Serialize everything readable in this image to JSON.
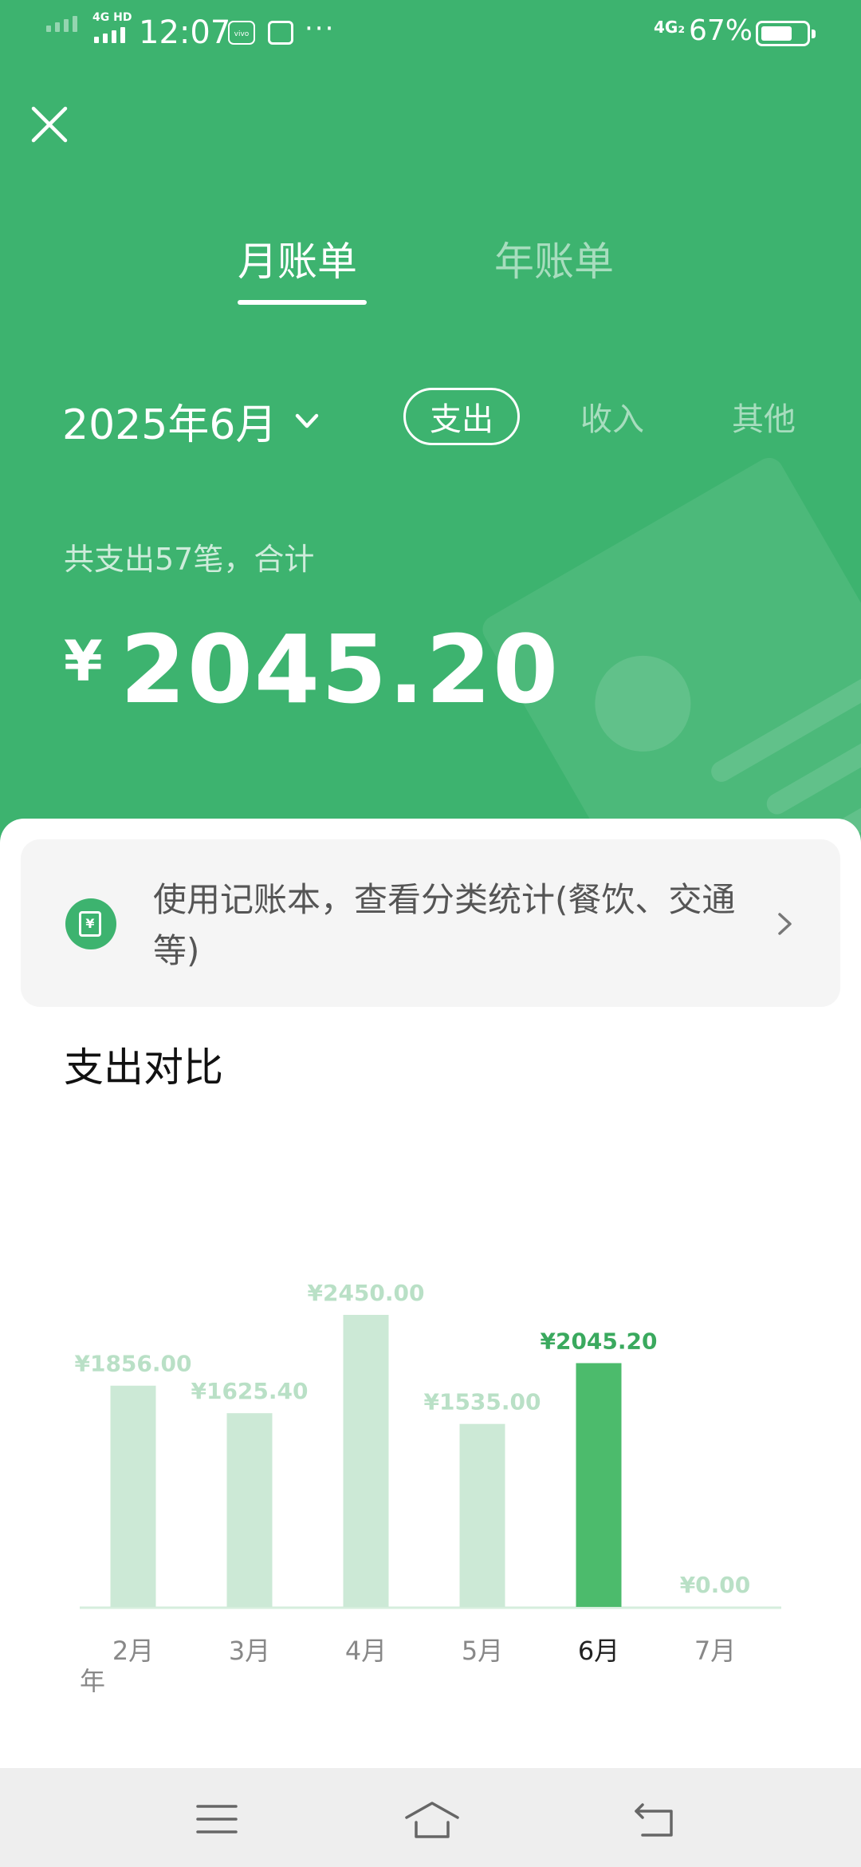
{
  "status_bar": {
    "time": "12:07",
    "network_top": "4G HD",
    "network_right": "4G₂",
    "battery": "67%",
    "battery_level": 0.67,
    "more": "···"
  },
  "tabs": [
    {
      "label": "月账单",
      "active": true
    },
    {
      "label": "年账单",
      "active": false
    }
  ],
  "period": {
    "label": "2025年6月"
  },
  "filters": [
    {
      "label": "支出",
      "selected": true
    },
    {
      "label": "收入",
      "selected": false
    },
    {
      "label": "其他",
      "selected": false
    }
  ],
  "summary": {
    "text": "共支出57笔，合计",
    "currency": "¥",
    "amount": "2045.20"
  },
  "promo": {
    "text": "使用记账本，查看分类统计(餐饮、交通等)",
    "icon_text": "¥"
  },
  "chart_section": {
    "title": "支出对比",
    "year_label": "年"
  },
  "chart_data": {
    "type": "bar",
    "categories": [
      "2月",
      "3月",
      "4月",
      "5月",
      "6月",
      "7月"
    ],
    "values": [
      1856.0,
      1625.4,
      2450.0,
      1535.0,
      2045.2,
      0.0
    ],
    "value_labels": [
      "¥1856.00",
      "¥1625.40",
      "¥2450.00",
      "¥1535.00",
      "¥2045.20",
      "¥0.00"
    ],
    "highlight_index": 4,
    "highlight_color": "#4cbb6c",
    "bar_color": "#cce9d6",
    "label_color": "#b9e0c6",
    "highlight_label_color": "#3aa95e",
    "ylim": [
      0,
      2450
    ]
  },
  "colors": {
    "brand": "#3db36f"
  }
}
